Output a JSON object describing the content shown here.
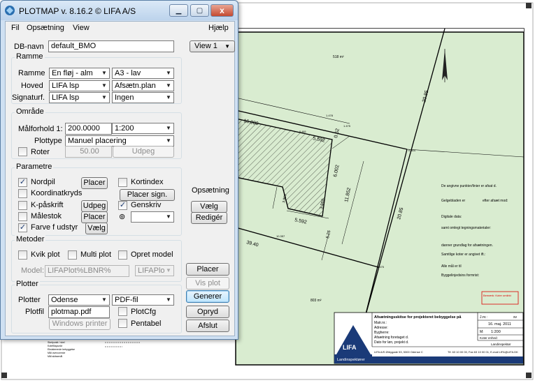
{
  "window": {
    "title": "PLOTMAP v. 8.16.2 © LIFA A/S",
    "min_icon": "minimize-icon",
    "max_icon": "maximize-icon",
    "close_label": "x"
  },
  "menu": {
    "file": "Fil",
    "setup": "Opsætning",
    "view": "View",
    "help": "Hjælp"
  },
  "db": {
    "label": "DB-navn",
    "value": "default_BMO",
    "view_value": "View 1"
  },
  "ramme": {
    "title": "Ramme",
    "ramme_label": "Ramme",
    "ramme_value": "En fløj - alm",
    "ramme_size": "A3 - lav",
    "hoved_label": "Hoved",
    "hoved_value": "LIFA lsp",
    "hoved_type": "Afsætn.plan",
    "signatur_label": "Signaturf.",
    "signatur_value": "LIFA lsp",
    "signatur_extra": "Ingen"
  },
  "omraade": {
    "title": "Område",
    "scale_label": "Målforhold 1:",
    "scale_value": "200.0000",
    "scale_combo": "1:200",
    "plottype_label": "Plottype",
    "plottype_value": "Manuel placering",
    "rotate_label": "Roter",
    "rotate_value": "50.00",
    "select_button": "Udpeg"
  },
  "parametre": {
    "title": "Parametre",
    "north_label": "Nordpil",
    "north_checked": true,
    "north_button": "Placer",
    "coord_label": "Koordinatkryds",
    "coord_checked": false,
    "kpaskrift_label": "K-påskrift",
    "kpaskrift_checked": false,
    "kpaskrift_button": "Udpeg",
    "scalebar_label": "Målestok",
    "scalebar_checked": false,
    "scalebar_button": "Placer",
    "color_label": "Farve f udstyr",
    "color_checked": true,
    "color_button": "Vælg",
    "keymap_label": "Kortindex",
    "keymap_checked": false,
    "place_sign_button": "Placer sign.",
    "genskriv_label": "Genskriv",
    "genskriv_checked": true,
    "genskriv_symbol": "⊚",
    "genskriv_value": "",
    "setup_title": "Opsætning",
    "setup_select": "Vælg",
    "setup_edit": "Redigér"
  },
  "metoder": {
    "title": "Metoder",
    "quick_label": "Kvik plot",
    "quick_checked": false,
    "multi_label": "Multi plot",
    "multi_checked": false,
    "create_label": "Opret model",
    "create_checked": false,
    "model_label": "Model:",
    "model_value": "LIFAPlot%LBNR%",
    "model_combo": "LIFAPlo"
  },
  "plotter": {
    "title": "Plotter",
    "plotter_label": "Plotter",
    "plotter_value": "Odense",
    "format_value": "PDF-fil",
    "file_label": "Plotfil",
    "file_value": "plotmap.pdf",
    "plotcfg_label": "PlotCfg",
    "plotcfg_checked": false,
    "pentable_label": "Pentabel",
    "pentable_checked": false,
    "windows_printer_button": "Windows printer"
  },
  "actions": {
    "place": "Placer",
    "view_plot": "Vis plot",
    "generate": "Generer",
    "clear": "Opryd",
    "quit": "Afslut"
  },
  "drawing": {
    "area1": "518 m²",
    "area2": "803 m²",
    "dims": [
      "16.000",
      "5.592",
      "0.52",
      "6.002",
      "11.852",
      "3.960",
      "5.592",
      "3.960",
      "5.26",
      "39.40",
      "20.85",
      "20.85",
      "1.478",
      "1.475",
      "0.504",
      "10.357",
      "0.475",
      "0.461"
    ],
    "notes": [
      "De angivne punkter/linier er afsat d.",
      "Gelgebladen er",
      "efter afsæt mod:",
      "Digitale data:",
      "samt omlegt tegningsmaterialer:",
      "danner grundlag for afsætningen.",
      "Samtlige koter er angivet ift.:",
      "Alle mål er til",
      "Byggelinjedsins formrist:"
    ],
    "remark": "Bemærk: Koter omlirkt",
    "title_block": {
      "heading": "Afsætningsskitse for projekteret bebyggelse på",
      "rows": [
        "Matr.nr.:",
        "Adresse:",
        "Bygherre:",
        "Afsætning foretaget d.",
        "Dato for løn, projekt d."
      ],
      "journal_label": "J.nr.:",
      "journal_value": "",
      "sign_label": "sv",
      "date": "16. maj. 2011",
      "scale_label": "M:",
      "scale": "1:200",
      "kote_label": "Koter enhed:",
      "role": "Landinspektør",
      "logo": "LIFA",
      "company": "Landinspektører",
      "address": "LIFA A/S  Ørbygade 53, 5300 Odense C",
      "phone": "Tlf. 63 10 00 00, Fax 63 10 00 01, E-mail LIFA@LIFA.DK"
    },
    "legend": [
      "Skelpunkt / skel",
      "Kotefikspunkt",
      "Eksisterende bebyggelse",
      "Mål overcorrede",
      "Mål skitsemål"
    ]
  }
}
